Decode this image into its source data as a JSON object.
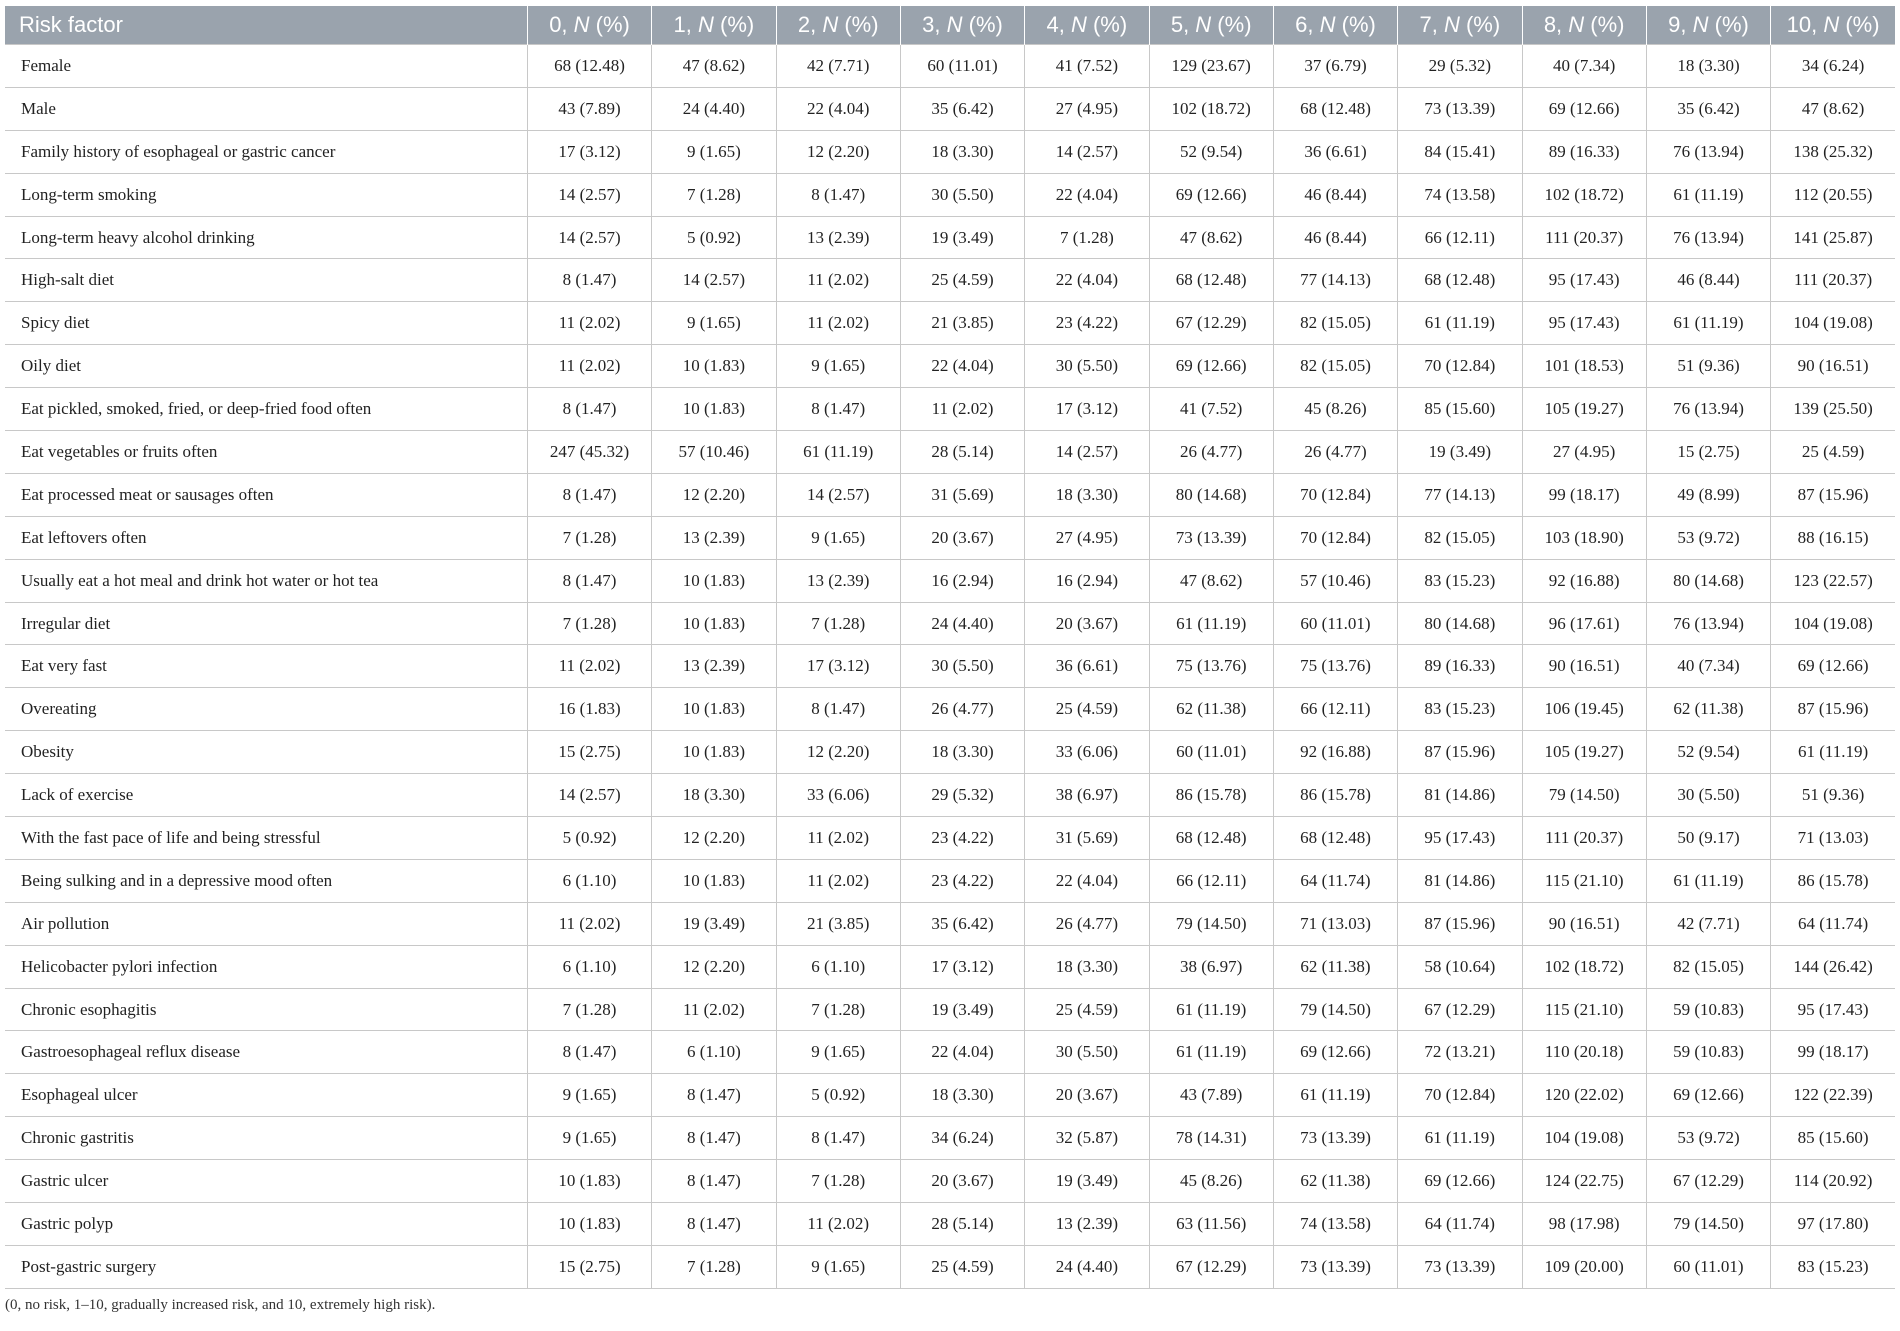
{
  "table": {
    "headers": [
      "Risk factor",
      "0, N (%)",
      "1, N (%)",
      "2, N (%)",
      "3, N (%)",
      "4, N (%)",
      "5, N (%)",
      "6, N (%)",
      "7, N (%)",
      "8, N (%)",
      "9, N (%)",
      "10, N (%)"
    ],
    "header_parts": [
      {
        "pre": "0, ",
        "n": "N",
        "post": " (%)"
      },
      {
        "pre": "1, ",
        "n": "N",
        "post": " (%)"
      },
      {
        "pre": "2, ",
        "n": "N",
        "post": " (%)"
      },
      {
        "pre": "3, ",
        "n": "N",
        "post": " (%)"
      },
      {
        "pre": "4, ",
        "n": "N",
        "post": " (%)"
      },
      {
        "pre": "5, ",
        "n": "N",
        "post": " (%)"
      },
      {
        "pre": "6, ",
        "n": "N",
        "post": " (%)"
      },
      {
        "pre": "7, ",
        "n": "N",
        "post": " (%)"
      },
      {
        "pre": "8, ",
        "n": "N",
        "post": " (%)"
      },
      {
        "pre": "9, ",
        "n": "N",
        "post": " (%)"
      },
      {
        "pre": "10, ",
        "n": "N",
        "post": " (%)"
      }
    ],
    "rows": [
      [
        "Female",
        "68 (12.48)",
        "47 (8.62)",
        "42 (7.71)",
        "60 (11.01)",
        "41 (7.52)",
        "129 (23.67)",
        "37 (6.79)",
        "29 (5.32)",
        "40 (7.34)",
        "18 (3.30)",
        "34 (6.24)"
      ],
      [
        "Male",
        "43 (7.89)",
        "24 (4.40)",
        "22 (4.04)",
        "35 (6.42)",
        "27 (4.95)",
        "102 (18.72)",
        "68 (12.48)",
        "73 (13.39)",
        "69 (12.66)",
        "35 (6.42)",
        "47 (8.62)"
      ],
      [
        "Family history of esophageal or gastric cancer",
        "17 (3.12)",
        "9 (1.65)",
        "12 (2.20)",
        "18 (3.30)",
        "14 (2.57)",
        "52 (9.54)",
        "36 (6.61)",
        "84 (15.41)",
        "89 (16.33)",
        "76 (13.94)",
        "138 (25.32)"
      ],
      [
        "Long-term smoking",
        "14 (2.57)",
        "7 (1.28)",
        "8 (1.47)",
        "30 (5.50)",
        "22 (4.04)",
        "69 (12.66)",
        "46 (8.44)",
        "74 (13.58)",
        "102 (18.72)",
        "61 (11.19)",
        "112 (20.55)"
      ],
      [
        "Long-term heavy alcohol drinking",
        "14 (2.57)",
        "5 (0.92)",
        "13 (2.39)",
        "19 (3.49)",
        "7 (1.28)",
        "47 (8.62)",
        "46 (8.44)",
        "66 (12.11)",
        "111 (20.37)",
        "76 (13.94)",
        "141 (25.87)"
      ],
      [
        "High-salt diet",
        "8 (1.47)",
        "14 (2.57)",
        "11 (2.02)",
        "25 (4.59)",
        "22 (4.04)",
        "68 (12.48)",
        "77 (14.13)",
        "68 (12.48)",
        "95 (17.43)",
        "46 (8.44)",
        "111 (20.37)"
      ],
      [
        "Spicy diet",
        "11 (2.02)",
        "9 (1.65)",
        "11 (2.02)",
        "21 (3.85)",
        "23 (4.22)",
        "67 (12.29)",
        "82 (15.05)",
        "61 (11.19)",
        "95 (17.43)",
        "61 (11.19)",
        "104 (19.08)"
      ],
      [
        "Oily diet",
        "11 (2.02)",
        "10 (1.83)",
        "9 (1.65)",
        "22 (4.04)",
        "30 (5.50)",
        "69 (12.66)",
        "82 (15.05)",
        "70 (12.84)",
        "101 (18.53)",
        "51 (9.36)",
        "90 (16.51)"
      ],
      [
        "Eat pickled, smoked, fried, or deep-fried food often",
        "8 (1.47)",
        "10 (1.83)",
        "8 (1.47)",
        "11 (2.02)",
        "17 (3.12)",
        "41 (7.52)",
        "45 (8.26)",
        "85 (15.60)",
        "105 (19.27)",
        "76 (13.94)",
        "139 (25.50)"
      ],
      [
        "Eat vegetables or fruits often",
        "247 (45.32)",
        "57 (10.46)",
        "61 (11.19)",
        "28 (5.14)",
        "14 (2.57)",
        "26 (4.77)",
        "26 (4.77)",
        "19 (3.49)",
        "27 (4.95)",
        "15 (2.75)",
        "25 (4.59)"
      ],
      [
        "Eat processed meat or sausages often",
        "8 (1.47)",
        "12 (2.20)",
        "14 (2.57)",
        "31 (5.69)",
        "18 (3.30)",
        "80 (14.68)",
        "70 (12.84)",
        "77 (14.13)",
        "99 (18.17)",
        "49 (8.99)",
        "87 (15.96)"
      ],
      [
        "Eat leftovers often",
        "7 (1.28)",
        "13 (2.39)",
        "9 (1.65)",
        "20 (3.67)",
        "27 (4.95)",
        "73 (13.39)",
        "70 (12.84)",
        "82 (15.05)",
        "103 (18.90)",
        "53 (9.72)",
        "88 (16.15)"
      ],
      [
        "Usually eat a hot meal and drink hot water or hot tea",
        "8 (1.47)",
        "10 (1.83)",
        "13 (2.39)",
        "16 (2.94)",
        "16 (2.94)",
        "47 (8.62)",
        "57 (10.46)",
        "83 (15.23)",
        "92 (16.88)",
        "80 (14.68)",
        "123 (22.57)"
      ],
      [
        "Irregular diet",
        "7 (1.28)",
        "10 (1.83)",
        "7 (1.28)",
        "24 (4.40)",
        "20 (3.67)",
        "61 (11.19)",
        "60 (11.01)",
        "80 (14.68)",
        "96 (17.61)",
        "76 (13.94)",
        "104 (19.08)"
      ],
      [
        "Eat very fast",
        "11 (2.02)",
        "13 (2.39)",
        "17 (3.12)",
        "30 (5.50)",
        "36 (6.61)",
        "75 (13.76)",
        "75 (13.76)",
        "89 (16.33)",
        "90 (16.51)",
        "40 (7.34)",
        "69 (12.66)"
      ],
      [
        "Overeating",
        "16 (1.83)",
        "10 (1.83)",
        "8 (1.47)",
        "26 (4.77)",
        "25 (4.59)",
        "62 (11.38)",
        "66 (12.11)",
        "83 (15.23)",
        "106 (19.45)",
        "62 (11.38)",
        "87 (15.96)"
      ],
      [
        "Obesity",
        "15 (2.75)",
        "10 (1.83)",
        "12 (2.20)",
        "18 (3.30)",
        "33 (6.06)",
        "60 (11.01)",
        "92 (16.88)",
        "87 (15.96)",
        "105 (19.27)",
        "52 (9.54)",
        "61 (11.19)"
      ],
      [
        "Lack of exercise",
        "14 (2.57)",
        "18 (3.30)",
        "33 (6.06)",
        "29 (5.32)",
        "38 (6.97)",
        "86 (15.78)",
        "86 (15.78)",
        "81 (14.86)",
        "79 (14.50)",
        "30 (5.50)",
        "51 (9.36)"
      ],
      [
        "With the fast pace of life and being stressful",
        "5 (0.92)",
        "12 (2.20)",
        "11 (2.02)",
        "23 (4.22)",
        "31 (5.69)",
        "68 (12.48)",
        "68 (12.48)",
        "95 (17.43)",
        "111 (20.37)",
        "50 (9.17)",
        "71 (13.03)"
      ],
      [
        "Being sulking and in a depressive mood often",
        "6 (1.10)",
        "10 (1.83)",
        "11 (2.02)",
        "23 (4.22)",
        "22 (4.04)",
        "66 (12.11)",
        "64 (11.74)",
        "81 (14.86)",
        "115 (21.10)",
        "61 (11.19)",
        "86 (15.78)"
      ],
      [
        "Air pollution",
        "11 (2.02)",
        "19 (3.49)",
        "21 (3.85)",
        "35 (6.42)",
        "26 (4.77)",
        "79 (14.50)",
        "71 (13.03)",
        "87 (15.96)",
        "90 (16.51)",
        "42 (7.71)",
        "64 (11.74)"
      ],
      [
        "Helicobacter pylori infection",
        "6 (1.10)",
        "12 (2.20)",
        "6 (1.10)",
        "17 (3.12)",
        "18 (3.30)",
        "38 (6.97)",
        "62 (11.38)",
        "58 (10.64)",
        "102 (18.72)",
        "82 (15.05)",
        "144 (26.42)"
      ],
      [
        "Chronic esophagitis",
        "7 (1.28)",
        "11 (2.02)",
        "7 (1.28)",
        "19 (3.49)",
        "25 (4.59)",
        "61 (11.19)",
        "79 (14.50)",
        "67 (12.29)",
        "115 (21.10)",
        "59 (10.83)",
        "95 (17.43)"
      ],
      [
        "Gastroesophageal reflux disease",
        "8 (1.47)",
        "6 (1.10)",
        "9 (1.65)",
        "22 (4.04)",
        "30 (5.50)",
        "61 (11.19)",
        "69 (12.66)",
        "72 (13.21)",
        "110 (20.18)",
        "59 (10.83)",
        "99 (18.17)"
      ],
      [
        "Esophageal ulcer",
        "9 (1.65)",
        "8 (1.47)",
        "5 (0.92)",
        "18 (3.30)",
        "20 (3.67)",
        "43 (7.89)",
        "61 (11.19)",
        "70 (12.84)",
        "120 (22.02)",
        "69 (12.66)",
        "122 (22.39)"
      ],
      [
        "Chronic gastritis",
        "9 (1.65)",
        "8 (1.47)",
        "8 (1.47)",
        "34 (6.24)",
        "32 (5.87)",
        "78 (14.31)",
        "73 (13.39)",
        "61 (11.19)",
        "104 (19.08)",
        "53 (9.72)",
        "85 (15.60)"
      ],
      [
        "Gastric ulcer",
        "10 (1.83)",
        "8 (1.47)",
        "7 (1.28)",
        "20 (3.67)",
        "19 (3.49)",
        "45 (8.26)",
        "62 (11.38)",
        "69 (12.66)",
        "124 (22.75)",
        "67 (12.29)",
        "114 (20.92)"
      ],
      [
        "Gastric polyp",
        "10 (1.83)",
        "8 (1.47)",
        "11 (2.02)",
        "28 (5.14)",
        "13 (2.39)",
        "63 (11.56)",
        "74 (13.58)",
        "64 (11.74)",
        "98 (17.98)",
        "79 (14.50)",
        "97 (17.80)"
      ],
      [
        "Post-gastric surgery",
        "15 (2.75)",
        "7 (1.28)",
        "9 (1.65)",
        "25 (4.59)",
        "24 (4.40)",
        "67 (12.29)",
        "73 (13.39)",
        "73 (13.39)",
        "109 (20.00)",
        "60 (11.01)",
        "83 (15.23)"
      ]
    ]
  },
  "footnote": "(0, no risk, 1–10, gradually increased risk, and 10, extremely high risk)."
}
